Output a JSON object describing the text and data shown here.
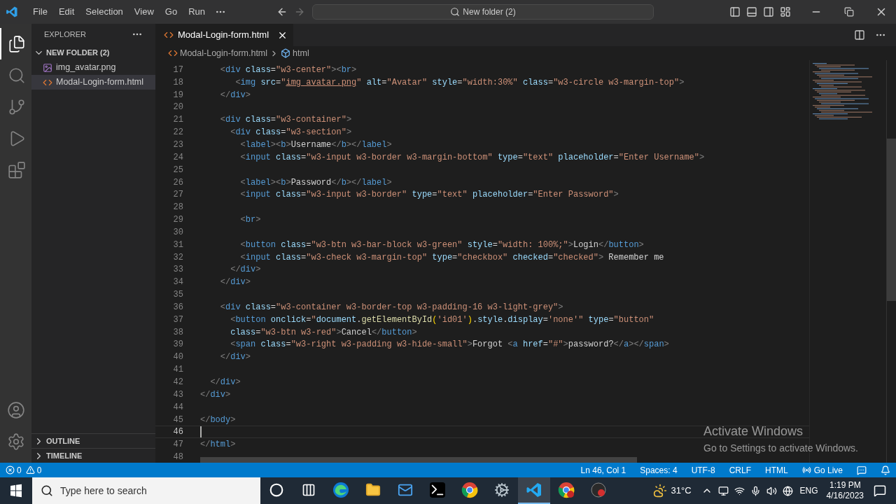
{
  "title_bar": {
    "menu": [
      "File",
      "Edit",
      "Selection",
      "View",
      "Go",
      "Run"
    ],
    "search": "New folder (2)"
  },
  "activity_bar": {
    "top": [
      {
        "kind": "explorer",
        "selected": true
      },
      {
        "kind": "search",
        "selected": false
      },
      {
        "kind": "source-control",
        "selected": false
      },
      {
        "kind": "run",
        "selected": false
      },
      {
        "kind": "extensions",
        "selected": false
      }
    ],
    "bottom": [
      {
        "kind": "account",
        "selected": false
      },
      {
        "kind": "settings",
        "selected": false
      }
    ]
  },
  "sidebar": {
    "title": "EXPLORER",
    "folder": {
      "name": "NEW FOLDER (2)",
      "expanded": true,
      "files": [
        {
          "name": "img_avatar.png",
          "kind": "image",
          "selected": false
        },
        {
          "name": "Modal-Login-form.html",
          "kind": "html",
          "selected": true
        }
      ]
    },
    "panels": [
      {
        "name": "OUTLINE",
        "expanded": false
      },
      {
        "name": "TIMELINE",
        "expanded": false
      }
    ]
  },
  "editor": {
    "tabs": [
      {
        "name": "Modal-Login-form.html",
        "kind": "html",
        "selected": true
      }
    ],
    "breadcrumb": [
      {
        "text": "Modal-Login-form.html",
        "kind": "html"
      },
      {
        "text": "html",
        "kind": "element"
      }
    ],
    "lines": [
      {
        "number": "17",
        "current": false,
        "tokens": [
          {
            "kind": "punct",
            "text": "    <"
          },
          {
            "kind": "tag",
            "text": "div"
          },
          {
            "kind": "attr",
            "text": " class"
          },
          {
            "kind": "equals",
            "text": "="
          },
          {
            "kind": "string",
            "text": "\"w3-center\""
          },
          {
            "kind": "punct",
            "text": "><"
          },
          {
            "kind": "tag",
            "text": "br"
          },
          {
            "kind": "punct",
            "text": ">"
          }
        ]
      },
      {
        "number": "18",
        "current": false,
        "tokens": [
          {
            "kind": "punct",
            "text": "       <"
          },
          {
            "kind": "tag",
            "text": "img"
          },
          {
            "kind": "attr",
            "text": " src"
          },
          {
            "kind": "equals",
            "text": "="
          },
          {
            "kind": "string",
            "text": "\""
          },
          {
            "kind": "link",
            "text": "img_avatar.png"
          },
          {
            "kind": "string",
            "text": "\""
          },
          {
            "kind": "attr",
            "text": " alt"
          },
          {
            "kind": "equals",
            "text": "="
          },
          {
            "kind": "string",
            "text": "\"Avatar\""
          },
          {
            "kind": "attr",
            "text": " style"
          },
          {
            "kind": "equals",
            "text": "="
          },
          {
            "kind": "string",
            "text": "\"width:30%\""
          },
          {
            "kind": "attr",
            "text": " class"
          },
          {
            "kind": "equals",
            "text": "="
          },
          {
            "kind": "string",
            "text": "\"w3-circle w3-margin-top\""
          },
          {
            "kind": "punct",
            "text": ">"
          }
        ]
      },
      {
        "number": "19",
        "current": false,
        "tokens": [
          {
            "kind": "punct",
            "text": "    </"
          },
          {
            "kind": "tag",
            "text": "div"
          },
          {
            "kind": "punct",
            "text": ">"
          }
        ]
      },
      {
        "number": "20",
        "current": false
      },
      {
        "number": "21",
        "current": false,
        "tokens": [
          {
            "kind": "punct",
            "text": "    <"
          },
          {
            "kind": "tag",
            "text": "div"
          },
          {
            "kind": "attr",
            "text": " class"
          },
          {
            "kind": "equals",
            "text": "="
          },
          {
            "kind": "string",
            "text": "\"w3-container\""
          },
          {
            "kind": "punct",
            "text": ">"
          }
        ]
      },
      {
        "number": "22",
        "current": false,
        "tokens": [
          {
            "kind": "punct",
            "text": "      <"
          },
          {
            "kind": "tag",
            "text": "div"
          },
          {
            "kind": "attr",
            "text": " class"
          },
          {
            "kind": "equals",
            "text": "="
          },
          {
            "kind": "string",
            "text": "\"w3-section\""
          },
          {
            "kind": "punct",
            "text": ">"
          }
        ]
      },
      {
        "number": "23",
        "current": false,
        "tokens": [
          {
            "kind": "punct",
            "text": "        <"
          },
          {
            "kind": "tag",
            "text": "label"
          },
          {
            "kind": "punct",
            "text": "><"
          },
          {
            "kind": "tag",
            "text": "b"
          },
          {
            "kind": "punct",
            "text": ">"
          },
          {
            "kind": "text",
            "text": "Username"
          },
          {
            "kind": "punct",
            "text": "</"
          },
          {
            "kind": "tag",
            "text": "b"
          },
          {
            "kind": "punct",
            "text": "></"
          },
          {
            "kind": "tag",
            "text": "label"
          },
          {
            "kind": "punct",
            "text": ">"
          }
        ]
      },
      {
        "number": "24",
        "current": false,
        "tokens": [
          {
            "kind": "punct",
            "text": "        <"
          },
          {
            "kind": "tag",
            "text": "input"
          },
          {
            "kind": "attr",
            "text": " class"
          },
          {
            "kind": "equals",
            "text": "="
          },
          {
            "kind": "string",
            "text": "\"w3-input w3-border w3-margin-bottom\""
          },
          {
            "kind": "attr",
            "text": " type"
          },
          {
            "kind": "equals",
            "text": "="
          },
          {
            "kind": "string",
            "text": "\"text\""
          },
          {
            "kind": "attr",
            "text": " placeholder"
          },
          {
            "kind": "equals",
            "text": "="
          },
          {
            "kind": "string",
            "text": "\"Enter Username\""
          },
          {
            "kind": "punct",
            "text": ">"
          }
        ]
      },
      {
        "number": "25",
        "current": false
      },
      {
        "number": "26",
        "current": false,
        "tokens": [
          {
            "kind": "punct",
            "text": "        <"
          },
          {
            "kind": "tag",
            "text": "label"
          },
          {
            "kind": "punct",
            "text": "><"
          },
          {
            "kind": "tag",
            "text": "b"
          },
          {
            "kind": "punct",
            "text": ">"
          },
          {
            "kind": "text",
            "text": "Password"
          },
          {
            "kind": "punct",
            "text": "</"
          },
          {
            "kind": "tag",
            "text": "b"
          },
          {
            "kind": "punct",
            "text": "></"
          },
          {
            "kind": "tag",
            "text": "label"
          },
          {
            "kind": "punct",
            "text": ">"
          }
        ]
      },
      {
        "number": "27",
        "current": false,
        "tokens": [
          {
            "kind": "punct",
            "text": "        <"
          },
          {
            "kind": "tag",
            "text": "input"
          },
          {
            "kind": "attr",
            "text": " class"
          },
          {
            "kind": "equals",
            "text": "="
          },
          {
            "kind": "string",
            "text": "\"w3-input w3-border\""
          },
          {
            "kind": "attr",
            "text": " type"
          },
          {
            "kind": "equals",
            "text": "="
          },
          {
            "kind": "string",
            "text": "\"text\""
          },
          {
            "kind": "attr",
            "text": " placeholder"
          },
          {
            "kind": "equals",
            "text": "="
          },
          {
            "kind": "string",
            "text": "\"Enter Password\""
          },
          {
            "kind": "punct",
            "text": ">"
          }
        ]
      },
      {
        "number": "28",
        "current": false
      },
      {
        "number": "29",
        "current": false,
        "tokens": [
          {
            "kind": "punct",
            "text": "        <"
          },
          {
            "kind": "tag",
            "text": "br"
          },
          {
            "kind": "punct",
            "text": ">"
          }
        ]
      },
      {
        "number": "30",
        "current": false
      },
      {
        "number": "31",
        "current": false,
        "tokens": [
          {
            "kind": "punct",
            "text": "        <"
          },
          {
            "kind": "tag",
            "text": "button"
          },
          {
            "kind": "attr",
            "text": " class"
          },
          {
            "kind": "equals",
            "text": "="
          },
          {
            "kind": "string",
            "text": "\"w3-btn w3-bar-block w3-green\""
          },
          {
            "kind": "attr",
            "text": " style"
          },
          {
            "kind": "equals",
            "text": "="
          },
          {
            "kind": "string",
            "text": "\"width: 100%;\""
          },
          {
            "kind": "punct",
            "text": ">"
          },
          {
            "kind": "text",
            "text": "Login"
          },
          {
            "kind": "punct",
            "text": "</"
          },
          {
            "kind": "tag",
            "text": "button"
          },
          {
            "kind": "punct",
            "text": ">"
          }
        ]
      },
      {
        "number": "32",
        "current": false,
        "tokens": [
          {
            "kind": "punct",
            "text": "        <"
          },
          {
            "kind": "tag",
            "text": "input"
          },
          {
            "kind": "attr",
            "text": " class"
          },
          {
            "kind": "equals",
            "text": "="
          },
          {
            "kind": "string",
            "text": "\"w3-check w3-margin-top\""
          },
          {
            "kind": "attr",
            "text": " type"
          },
          {
            "kind": "equals",
            "text": "="
          },
          {
            "kind": "string",
            "text": "\"checkbox\""
          },
          {
            "kind": "attr",
            "text": " checked"
          },
          {
            "kind": "equals",
            "text": "="
          },
          {
            "kind": "string",
            "text": "\"checked\""
          },
          {
            "kind": "punct",
            "text": ">"
          },
          {
            "kind": "text",
            "text": " Remember me"
          }
        ]
      },
      {
        "number": "33",
        "current": false,
        "tokens": [
          {
            "kind": "punct",
            "text": "      </"
          },
          {
            "kind": "tag",
            "text": "div"
          },
          {
            "kind": "punct",
            "text": ">"
          }
        ]
      },
      {
        "number": "34",
        "current": false,
        "tokens": [
          {
            "kind": "punct",
            "text": "    </"
          },
          {
            "kind": "tag",
            "text": "div"
          },
          {
            "kind": "punct",
            "text": ">"
          }
        ]
      },
      {
        "number": "35",
        "current": false
      },
      {
        "number": "36",
        "current": false,
        "tokens": [
          {
            "kind": "punct",
            "text": "    <"
          },
          {
            "kind": "tag",
            "text": "div"
          },
          {
            "kind": "attr",
            "text": " class"
          },
          {
            "kind": "equals",
            "text": "="
          },
          {
            "kind": "string",
            "text": "\"w3-container w3-border-top w3-padding-16 w3-light-grey\""
          },
          {
            "kind": "punct",
            "text": ">"
          }
        ]
      },
      {
        "number": "37",
        "current": false,
        "tokens": [
          {
            "kind": "punct",
            "text": "      <"
          },
          {
            "kind": "tag",
            "text": "button"
          },
          {
            "kind": "attr",
            "text": " onclick"
          },
          {
            "kind": "equals",
            "text": "="
          },
          {
            "kind": "string",
            "text": "\""
          },
          {
            "kind": "variable",
            "text": "document"
          },
          {
            "kind": "text",
            "text": "."
          },
          {
            "kind": "function",
            "text": "getElementById"
          },
          {
            "kind": "bracket",
            "text": "("
          },
          {
            "kind": "string",
            "text": "'id01'"
          },
          {
            "kind": "bracket",
            "text": ")"
          },
          {
            "kind": "text",
            "text": "."
          },
          {
            "kind": "variable",
            "text": "style"
          },
          {
            "kind": "text",
            "text": "."
          },
          {
            "kind": "variable",
            "text": "display"
          },
          {
            "kind": "text",
            "text": "="
          },
          {
            "kind": "string",
            "text": "'none'\""
          },
          {
            "kind": "attr",
            "text": " type"
          },
          {
            "kind": "equals",
            "text": "="
          },
          {
            "kind": "string",
            "text": "\"button\""
          }
        ]
      },
      {
        "number": "38",
        "current": false,
        "tokens": [
          {
            "kind": "attr",
            "text": "      class"
          },
          {
            "kind": "equals",
            "text": "="
          },
          {
            "kind": "string",
            "text": "\"w3-btn w3-red\""
          },
          {
            "kind": "punct",
            "text": ">"
          },
          {
            "kind": "text",
            "text": "Cancel"
          },
          {
            "kind": "punct",
            "text": "</"
          },
          {
            "kind": "tag",
            "text": "button"
          },
          {
            "kind": "punct",
            "text": ">"
          }
        ]
      },
      {
        "number": "39",
        "current": false,
        "tokens": [
          {
            "kind": "punct",
            "text": "      <"
          },
          {
            "kind": "tag",
            "text": "span"
          },
          {
            "kind": "attr",
            "text": " class"
          },
          {
            "kind": "equals",
            "text": "="
          },
          {
            "kind": "string",
            "text": "\"w3-right w3-padding w3-hide-small\""
          },
          {
            "kind": "punct",
            "text": ">"
          },
          {
            "kind": "text",
            "text": "Forgot "
          },
          {
            "kind": "punct",
            "text": "<"
          },
          {
            "kind": "tag",
            "text": "a"
          },
          {
            "kind": "attr",
            "text": " href"
          },
          {
            "kind": "equals",
            "text": "="
          },
          {
            "kind": "string",
            "text": "\"#\""
          },
          {
            "kind": "punct",
            "text": ">"
          },
          {
            "kind": "text",
            "text": "password?"
          },
          {
            "kind": "punct",
            "text": "</"
          },
          {
            "kind": "tag",
            "text": "a"
          },
          {
            "kind": "punct",
            "text": "></"
          },
          {
            "kind": "tag",
            "text": "span"
          },
          {
            "kind": "punct",
            "text": ">"
          }
        ]
      },
      {
        "number": "40",
        "current": false,
        "tokens": [
          {
            "kind": "punct",
            "text": "    </"
          },
          {
            "kind": "tag",
            "text": "div"
          },
          {
            "kind": "punct",
            "text": ">"
          }
        ]
      },
      {
        "number": "41",
        "current": false
      },
      {
        "number": "42",
        "current": false,
        "tokens": [
          {
            "kind": "punct",
            "text": "  </"
          },
          {
            "kind": "tag",
            "text": "div"
          },
          {
            "kind": "punct",
            "text": ">"
          }
        ]
      },
      {
        "number": "43",
        "current": false,
        "tokens": [
          {
            "kind": "punct",
            "text": "</"
          },
          {
            "kind": "tag",
            "text": "div"
          },
          {
            "kind": "punct",
            "text": ">"
          }
        ]
      },
      {
        "number": "44",
        "current": false
      },
      {
        "number": "45",
        "current": false,
        "tokens": [
          {
            "kind": "punct",
            "text": "</"
          },
          {
            "kind": "tag",
            "text": "body"
          },
          {
            "kind": "punct",
            "text": ">"
          }
        ]
      },
      {
        "number": "46",
        "current": true
      },
      {
        "number": "47",
        "current": false,
        "tokens": [
          {
            "kind": "punct",
            "text": "</"
          },
          {
            "kind": "tag",
            "text": "html"
          },
          {
            "kind": "punct",
            "text": ">"
          }
        ]
      },
      {
        "number": "48",
        "current": false
      }
    ]
  },
  "activation_notice": {
    "title": "Activate Windows",
    "message": "Go to Settings to activate Windows."
  },
  "status_bar": {
    "errors": "0",
    "warnings": "0",
    "items": [
      {
        "text": "Ln 46, Col 1",
        "kind": "plain"
      },
      {
        "text": "Spaces: 4",
        "kind": "plain"
      },
      {
        "text": "UTF-8",
        "kind": "plain"
      },
      {
        "text": "CRLF",
        "kind": "plain"
      },
      {
        "text": "HTML",
        "kind": "plain"
      },
      {
        "text": "Go Live",
        "kind": "live"
      }
    ]
  },
  "taskbar": {
    "search_placeholder": "Type here to search",
    "apps": [
      {
        "kind": "cortana",
        "active": false
      },
      {
        "kind": "taskview",
        "active": false
      },
      {
        "kind": "edge",
        "active": false
      },
      {
        "kind": "files",
        "active": false
      },
      {
        "kind": "mail",
        "active": false
      },
      {
        "kind": "terminal",
        "active": false
      },
      {
        "kind": "chrome",
        "active": false
      },
      {
        "kind": "settings",
        "active": false
      },
      {
        "kind": "vscode",
        "active": true
      },
      {
        "kind": "chrome-profile",
        "active": false
      },
      {
        "kind": "app",
        "active": false
      }
    ],
    "weather": "31°C",
    "language": "ENG",
    "time": "1:19 PM",
    "date": "4/16/2023"
  }
}
